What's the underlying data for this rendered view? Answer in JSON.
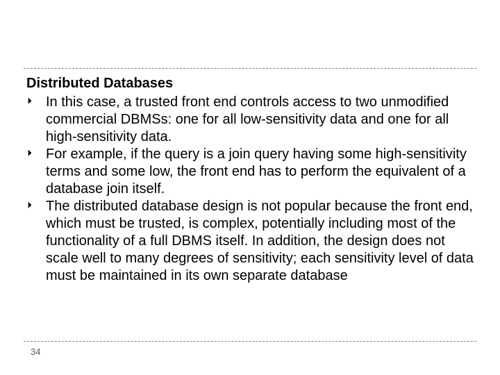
{
  "slide": {
    "heading": "Distributed Databases",
    "bullets": [
      "In this case, a trusted front end controls access to two unmodified commercial DBMSs: one for all low-sensitivity data and one for all high-sensitivity data.",
      " For example, if the query is a join query having some high-sensitivity terms and some low, the front end has to perform the equivalent of a database join itself.",
      "The distributed database design is not popular because the front end, which must be trusted, is complex, potentially including most of the functionality of a full DBMS itself. In addition, the design does not scale well to many degrees of sensitivity; each sensitivity level of data must be maintained in its own separate database"
    ],
    "page_number": "34"
  }
}
